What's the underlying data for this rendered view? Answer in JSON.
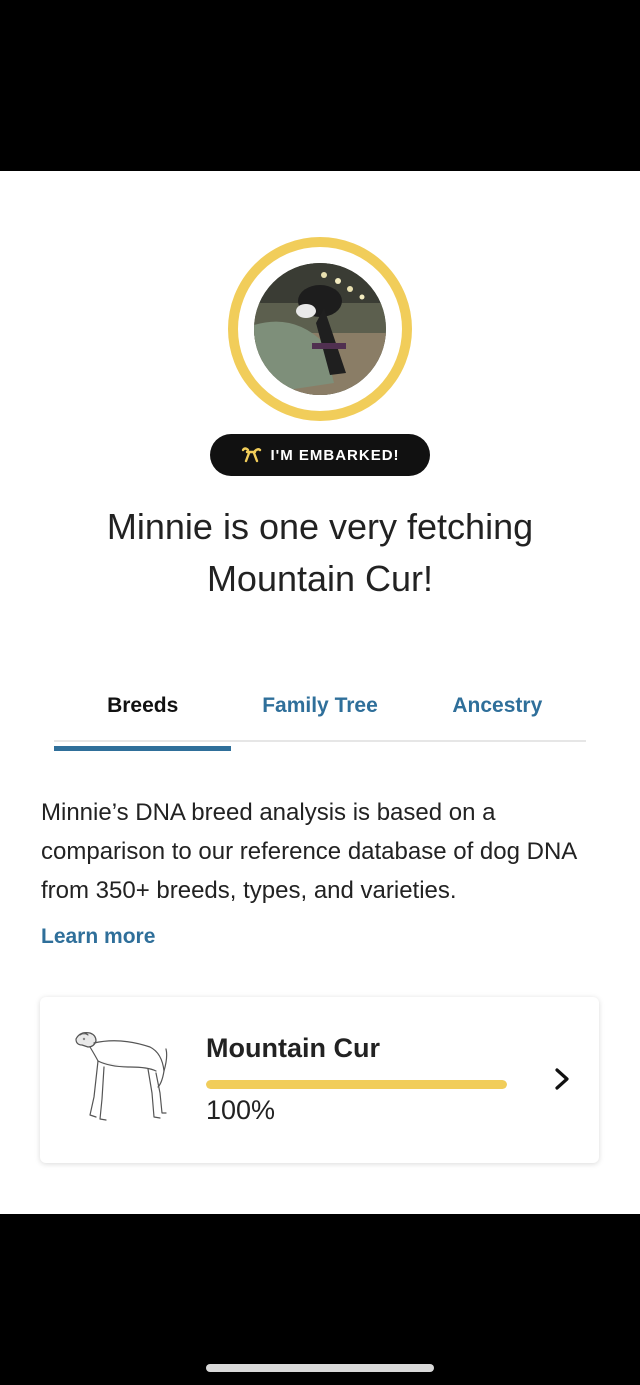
{
  "badge": {
    "label": "I'M EMBARKED!",
    "icon": "balloon-dog-icon"
  },
  "headline": {
    "line1": "Minnie is one very fetching",
    "line2": "Mountain Cur!"
  },
  "tabs": [
    {
      "label": "Breeds",
      "active": true
    },
    {
      "label": "Family Tree",
      "active": false
    },
    {
      "label": "Ancestry",
      "active": false
    }
  ],
  "description": "Minnie’s DNA breed analysis is based on a comparison to our reference database of dog DNA from 350+ breeds, types, and varieties.",
  "learn_more": "Learn more",
  "breed_card": {
    "name": "Mountain Cur",
    "percent_label": "100%",
    "percent": 100
  },
  "colors": {
    "accent": "#2f6f9a",
    "ring": "#f1cd5a",
    "badge_bg": "#111111"
  }
}
